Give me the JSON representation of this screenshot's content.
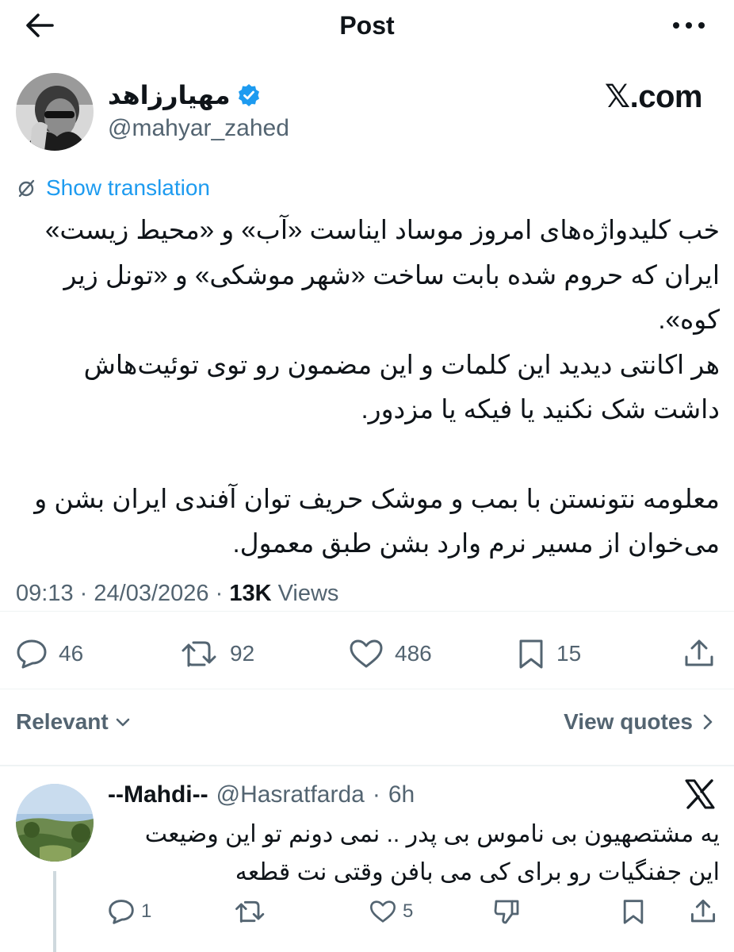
{
  "header": {
    "title": "Post"
  },
  "post": {
    "author_name": "مهیارزاهد",
    "handle": "@mahyar_zahed",
    "brand": "𝕏.com",
    "translate_label": "Show translation",
    "paragraphs": [
      "خب کلیدواژه‌های امروز موساد ایناست «آب» و «محیط زیست» ایران که حروم شده بابت ساخت «شهر موشکی» و «تونل زیر کوه».",
      "هر اکانتی دیدید این کلمات و این مضمون رو توی توئیت‌هاش داشت شک نکنید یا فیکه یا مزدور.",
      "معلومه نتونستن با بمب و موشک حریف توان آفندی ایران بشن و می‌خوان از مسیر نرم وارد بشن طبق معمول."
    ],
    "time": "09:13",
    "date": "24/03/2026",
    "views_count": "13K",
    "views_label": "Views",
    "separator": "·",
    "stats": {
      "replies": "46",
      "reposts": "92",
      "likes": "486",
      "bookmarks": "15"
    }
  },
  "sort": {
    "label": "Relevant",
    "view_quotes": "View quotes"
  },
  "reply": {
    "name": "--Mahdi--",
    "handle": "@Hasratfarda",
    "time": "6h",
    "separator": "·",
    "text": "یه مشتصهیون بی ناموس بی پدر .. نمی دونم تو این وضیعت این جفنگیات رو برای کی می بافن وقتی نت قطعه",
    "stats": {
      "replies": "1",
      "likes": "5"
    }
  },
  "colors": {
    "text": "#0f1419",
    "secondary": "#536471",
    "link": "#1d9bf0",
    "verified": "#1d9bf0",
    "divider": "#eff3f4"
  },
  "icons": [
    "back-arrow-icon",
    "more-icon",
    "verified-badge-icon",
    "translate-icon",
    "reply-icon",
    "repost-icon",
    "like-icon",
    "bookmark-icon",
    "share-icon",
    "chevron-down-icon",
    "chevron-right-icon",
    "x-logo-icon",
    "dislike-icon"
  ]
}
